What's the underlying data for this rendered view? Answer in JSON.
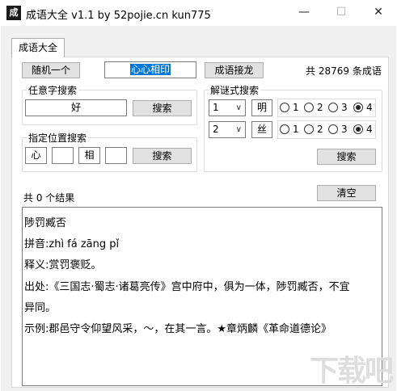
{
  "window": {
    "app_icon": "成",
    "title": "成语大全 v1.1 by 52pojie.cn kun775",
    "minimize_icon": "—",
    "maximize_icon": "☐",
    "close_icon": "✕"
  },
  "tab": {
    "label": "成语大全"
  },
  "top": {
    "random_button": "随机一个",
    "idiom_value": "心心相印",
    "chain_button": "成语接龙",
    "total_prefix": "共",
    "total_count": "28769",
    "total_suffix": "条成语"
  },
  "any_char_search": {
    "group_label": "任意字搜索",
    "input_value": "好",
    "search_button": "搜索"
  },
  "position_search": {
    "group_label": "指定位置搜索",
    "positions": [
      "心",
      "",
      "相",
      ""
    ],
    "search_button": "搜索"
  },
  "riddle_search": {
    "group_label": "解谜式搜索",
    "rows": [
      {
        "count_value": "1",
        "char_value": "明",
        "selected": 4
      },
      {
        "count_value": "2",
        "char_value": "丝",
        "selected": 4
      }
    ],
    "radio_labels": [
      "1",
      "2",
      "3",
      "4"
    ],
    "search_button": "搜索"
  },
  "results": {
    "count_text": "共 0 个结果",
    "clear_button": "清空",
    "lines": [
      "陟罚臧否",
      "拼音:zhì fá zāng pǐ",
      "释义:赏罚褒贬。",
      "出处:《三国志·蜀志·诸葛亮传》宫中府中，俱为一体，陟罚臧否，不宜",
      "异同。",
      "示例:郡邑守令仰望风采，～，在其一言。★章炳麟《革命道德论》"
    ]
  },
  "watermark": "下载吧"
}
